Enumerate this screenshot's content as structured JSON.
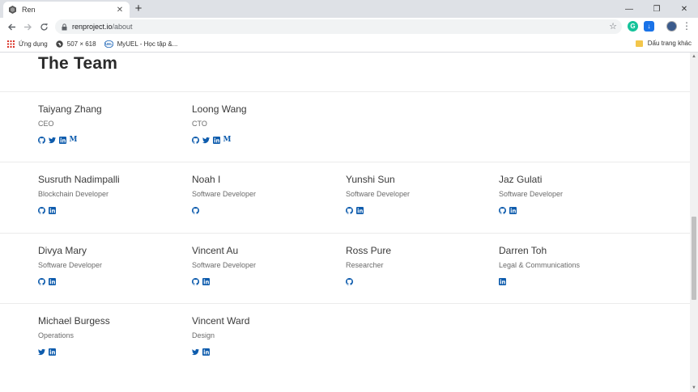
{
  "browser": {
    "tab_title": "Ren",
    "url_host": "renproject.io",
    "url_path": "/about",
    "bookmarks": [
      {
        "label": "Ứng dụng",
        "icon": "apps-icon"
      },
      {
        "label": "507 × 618",
        "icon": "globe-icon"
      },
      {
        "label": "MyUEL - Học tập &...",
        "icon": "myuel-icon"
      }
    ],
    "other_bookmarks": "Dấu trang khác"
  },
  "page": {
    "title": "The Team",
    "rows": [
      [
        {
          "name": "Taiyang Zhang",
          "role": "CEO",
          "socials": [
            "github",
            "twitter",
            "linkedin",
            "medium"
          ]
        },
        {
          "name": "Loong Wang",
          "role": "CTO",
          "socials": [
            "github",
            "twitter",
            "linkedin",
            "medium"
          ]
        }
      ],
      [
        {
          "name": "Susruth Nadimpalli",
          "role": "Blockchain Developer",
          "socials": [
            "github",
            "linkedin"
          ]
        },
        {
          "name": "Noah I",
          "role": "Software Developer",
          "socials": [
            "github"
          ]
        },
        {
          "name": "Yunshi Sun",
          "role": "Software Developer",
          "socials": [
            "github",
            "linkedin"
          ]
        },
        {
          "name": "Jaz Gulati",
          "role": "Software Developer",
          "socials": [
            "github",
            "linkedin"
          ]
        }
      ],
      [
        {
          "name": "Divya Mary",
          "role": "Software Developer",
          "socials": [
            "github",
            "linkedin"
          ]
        },
        {
          "name": "Vincent Au",
          "role": "Software Developer",
          "socials": [
            "github",
            "linkedin"
          ]
        },
        {
          "name": "Ross Pure",
          "role": "Researcher",
          "socials": [
            "github"
          ]
        },
        {
          "name": "Darren Toh",
          "role": "Legal & Communications",
          "socials": [
            "linkedin"
          ]
        }
      ],
      [
        {
          "name": "Michael Burgess",
          "role": "Operations",
          "socials": [
            "twitter",
            "linkedin"
          ]
        },
        {
          "name": "Vincent Ward",
          "role": "Design",
          "socials": [
            "twitter",
            "linkedin"
          ]
        }
      ]
    ]
  },
  "colors": {
    "social_icon": "#0e5cad",
    "name_text": "#3a3a3a",
    "role_text": "#6b6b6b"
  }
}
